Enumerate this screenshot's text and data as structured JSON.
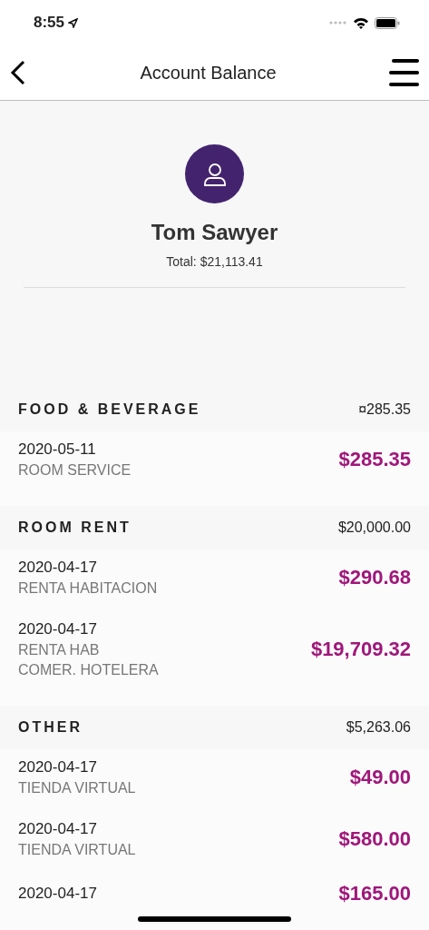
{
  "status_bar": {
    "time": "8:55"
  },
  "nav": {
    "title": "Account Balance"
  },
  "profile": {
    "name": "Tom Sawyer",
    "total": "Total: $21,113.41"
  },
  "sections": [
    {
      "title": "FOOD & BEVERAGE",
      "total": "¤285.35",
      "items": [
        {
          "date": "2020-05-11",
          "lines": [
            "ROOM SERVICE"
          ],
          "amount": "$285.35"
        }
      ]
    },
    {
      "title": "ROOM RENT",
      "total": "$20,000.00",
      "items": [
        {
          "date": "2020-04-17",
          "lines": [
            "RENTA HABITACION"
          ],
          "amount": "$290.68"
        },
        {
          "date": "2020-04-17",
          "lines": [
            "RENTA HAB",
            "COMER. HOTELERA"
          ],
          "amount": "$19,709.32"
        }
      ]
    },
    {
      "title": "OTHER",
      "total": "$5,263.06",
      "items": [
        {
          "date": "2020-04-17",
          "lines": [
            "TIENDA VIRTUAL"
          ],
          "amount": "$49.00"
        },
        {
          "date": "2020-04-17",
          "lines": [
            "TIENDA VIRTUAL"
          ],
          "amount": "$580.00"
        },
        {
          "date": "2020-04-17",
          "amount": "$165.00"
        }
      ]
    }
  ]
}
